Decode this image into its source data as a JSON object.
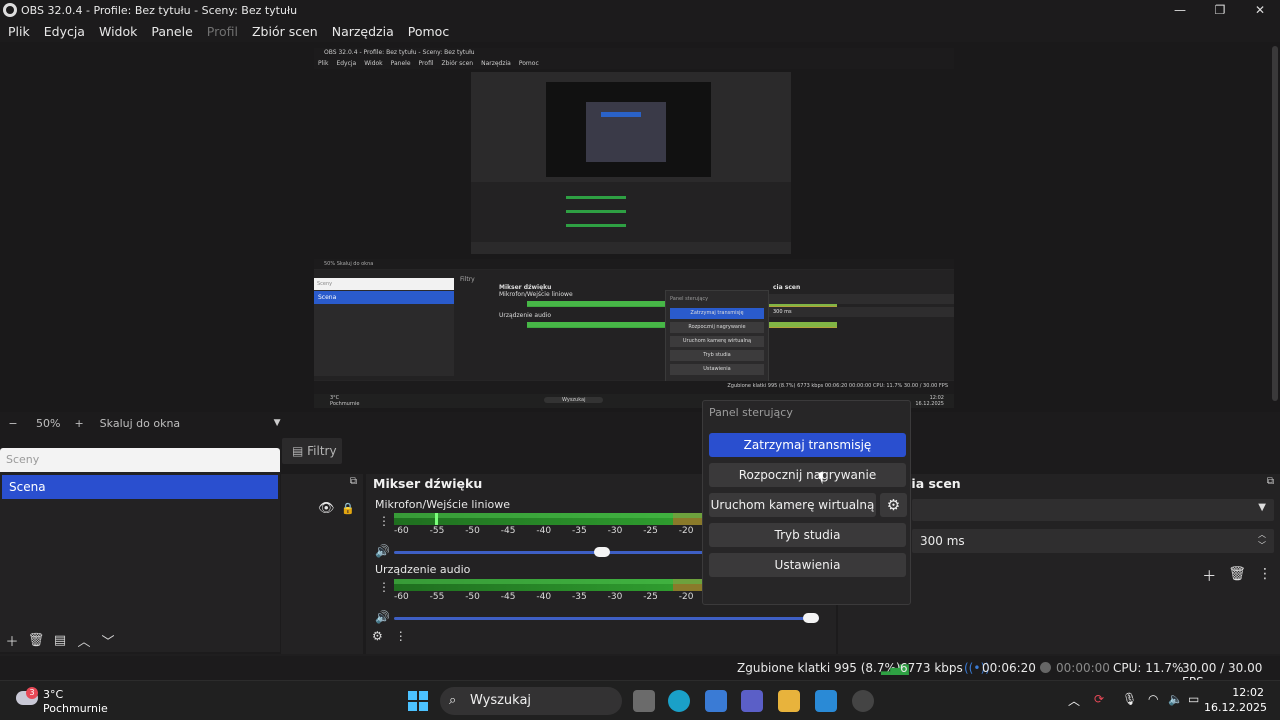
{
  "window": {
    "title": "OBS 32.0.4 - Profile: Bez tytułu - Sceny: Bez tytułu",
    "controls": {
      "minimize": "—",
      "maximize": "❐",
      "close": "✕"
    }
  },
  "menu": [
    {
      "label": "Plik",
      "enabled": true
    },
    {
      "label": "Edycja",
      "enabled": true
    },
    {
      "label": "Widok",
      "enabled": true
    },
    {
      "label": "Panele",
      "enabled": true
    },
    {
      "label": "Profil",
      "enabled": false
    },
    {
      "label": "Zbiór scen",
      "enabled": true
    },
    {
      "label": "Narzędzia",
      "enabled": true
    },
    {
      "label": "Pomoc",
      "enabled": true
    }
  ],
  "zoom": {
    "minus": "−",
    "value": "50%",
    "plus": "+",
    "mode": "Skaluj do okna"
  },
  "docks": {
    "filters_tab": "Filtry",
    "scenes": {
      "search_placeholder": "Sceny",
      "items": [
        "Scena"
      ]
    },
    "mixer": {
      "title": "Mikser dźwięku",
      "tracks": [
        {
          "name": "Mikrofon/Wejście liniowe",
          "volume_fraction": 0.49
        },
        {
          "name": "Urządzenie audio",
          "volume_fraction": 1.0
        }
      ],
      "ticks": [
        "-60",
        "-55",
        "-50",
        "-45",
        "-40",
        "-35",
        "-30",
        "-25",
        "-20"
      ]
    },
    "transitions": {
      "title": "cia scen",
      "duration": "300 ms"
    }
  },
  "control_dock": {
    "title": "Panel sterujący",
    "buttons": {
      "stream": "Zatrzymaj transmisję",
      "record": "Rozpocznij nagrywanie",
      "virtual_cam": "Uruchom kamerę wirtualną",
      "studio": "Tryb studia",
      "settings": "Ustawienia"
    }
  },
  "status": {
    "dropped": "Zgubione klatki 995 (8.7%)",
    "bitrate": "6773 kbps",
    "stream_time": "00:06:20",
    "rec_time": "00:00:00",
    "cpu": "CPU: 11.7%",
    "fps": "30.00 / 30.00 FPS"
  },
  "taskbar": {
    "weather_badge": "3",
    "temperature": "3°C",
    "condition": "Pochmurnie",
    "search": "Wyszukaj",
    "time": "12:02",
    "date": "16.12.2025"
  },
  "nested_preview": {
    "title": "OBS 32.0.4 - Profile: Bez tytułu - Sceny: Bez tytułu",
    "menu": [
      "Plik",
      "Edycja",
      "Widok",
      "Panele",
      "Profil",
      "Zbiór scen",
      "Narzędzia",
      "Pomoc"
    ],
    "scenes_label": "Sceny",
    "scene_item": "Scena",
    "filters": "Filtry",
    "mixer_title": "Mikser dźwięku",
    "mic": "Mikrofon/Wejście liniowe",
    "audio": "Urządzenie audio",
    "trans_title": "cia scen",
    "duration": "300 ms",
    "panel_title": "Panel sterujący",
    "panel_buttons": [
      "Zatrzymaj transmisję",
      "Rozpocznij nagrywanie",
      "Uruchom kamerę wirtualną",
      "Tryb studia",
      "Ustawienia"
    ],
    "status": "Zgubione klatki 995 (8.7%)   6773 kbps   00:06:20   00:00:00   CPU: 11.7%   30.00 / 30.00 FPS",
    "zoom": "50%",
    "zoom_mode": "Skaluj do okna",
    "search": "Wyszukaj",
    "temperature": "3°C",
    "condition": "Pochmurnie",
    "time": "12:02",
    "date": "16.12.2025"
  }
}
